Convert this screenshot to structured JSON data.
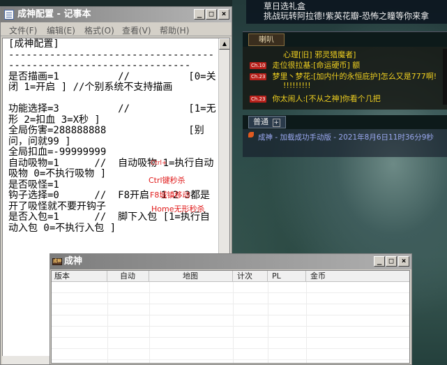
{
  "game": {
    "top_lines": [
      "草日选礼盒",
      "挑战玩转阿拉德!紫英花瓣-恐怖之瞳等你来拿"
    ],
    "channel_tab": "喇叭",
    "chat": [
      {
        "badge": "",
        "speaker": "心理[旧] 邪灵猎魔者]",
        "text": "",
        "color": "#f0d020"
      },
      {
        "badge": "Ch.10",
        "speaker": "走位很拉基",
        "text": ":[命运硬币] 额",
        "color": "#f0d020"
      },
      {
        "badge": "Ch.23",
        "speaker": "梦里丶梦花",
        "text": ":[加内什的永恒庇护]怎么又是777啊!",
        "color": "#f0d020"
      },
      {
        "badge": "",
        "speaker": "!!!!!!!!!",
        "text": "",
        "color": "#f0d020"
      },
      {
        "badge": "Ch.23",
        "speaker": "你太闹人",
        "text": ":[不从之神]你看个几把",
        "color": "#f0d020"
      }
    ],
    "normal_tab": "普通",
    "system_msg": "成神 - 加载成功手动版 - 2021年8月6日11时36分9秒",
    "accent_yellow": "#f0d020",
    "system_color": "#9aa8f0"
  },
  "notepad": {
    "title": "成神配置 - 记事本",
    "menu": [
      "文件(F)",
      "编辑(E)",
      "格式(O)",
      "查看(V)",
      "帮助(H)"
    ],
    "content": "[成神配置]\n------------------------------------------------------------------\n是否描画=1          //          [0=关闭 1=开启 ] //个别系统不支持描画\n\n功能选择=3          //          [1=无形 2=扣血 3=X秒 ]\n全局伤害=288888888              [别问，问就99 ]\n全局扣血=-99999999\n自动吸物=1      //  自动吸物 1=执行自动吸物 0=不执行吸物 ]\n是否吸怪=1\n钩子选择=0      //  F8开启  1 2 3都是 开了吸怪就不要开钩子\n是否入包=1      //  脚下入包 [1=执行自动入包 0=不执行入包 ]"
  },
  "overlay": {
    "lines": [
      "Ctrl+",
      "Ctrl键秒杀",
      "F8城镇移动",
      "Home无形秒杀"
    ],
    "color": "#e01818"
  },
  "cs_window": {
    "title": "成神",
    "icon_text": "成神",
    "columns": [
      "版本",
      "自动",
      "地图",
      "计次",
      "PL",
      "金币"
    ]
  }
}
